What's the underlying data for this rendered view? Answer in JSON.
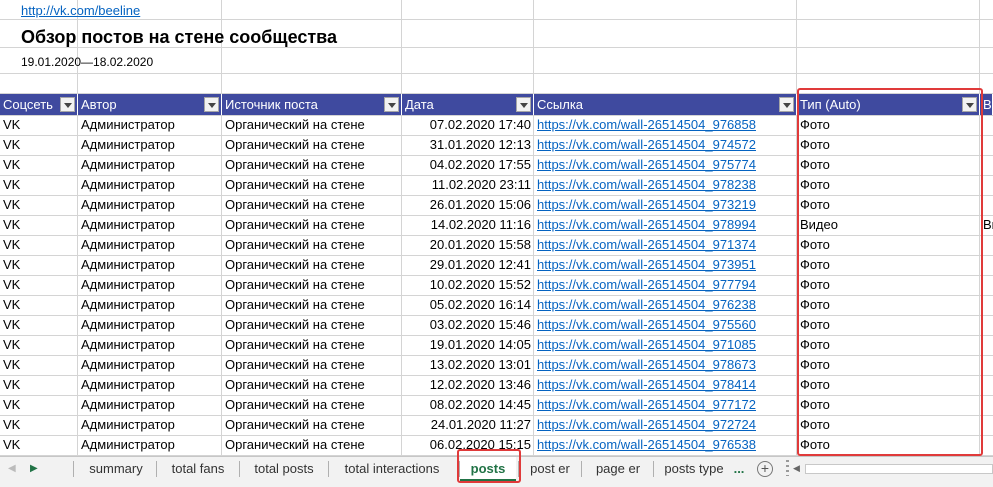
{
  "sheet": {
    "link": "http://vk.com/beeline",
    "title": "Обзор постов на стене сообщества",
    "date_range": "19.01.2020—18.02.2020",
    "columns": [
      "Соцсеть",
      "Автор",
      "Источник поста",
      "Дата",
      "Ссылка",
      "Тип (Auto)",
      "Во"
    ],
    "rows": [
      [
        "VK",
        "Администратор",
        "Органический на стене",
        "07.02.2020 17:40",
        "https://vk.com/wall-26514504_976858",
        "Фото",
        ""
      ],
      [
        "VK",
        "Администратор",
        "Органический на стене",
        "31.01.2020 12:13",
        "https://vk.com/wall-26514504_974572",
        "Фото",
        ""
      ],
      [
        "VK",
        "Администратор",
        "Органический на стене",
        "04.02.2020 17:55",
        "https://vk.com/wall-26514504_975774",
        "Фото",
        ""
      ],
      [
        "VK",
        "Администратор",
        "Органический на стене",
        "11.02.2020 23:11",
        "https://vk.com/wall-26514504_978238",
        "Фото",
        ""
      ],
      [
        "VK",
        "Администратор",
        "Органический на стене",
        "26.01.2020 15:06",
        "https://vk.com/wall-26514504_973219",
        "Фото",
        ""
      ],
      [
        "VK",
        "Администратор",
        "Органический на стене",
        "14.02.2020 11:16",
        "https://vk.com/wall-26514504_978994",
        "Видео",
        "Ви"
      ],
      [
        "VK",
        "Администратор",
        "Органический на стене",
        "20.01.2020 15:58",
        "https://vk.com/wall-26514504_971374",
        "Фото",
        ""
      ],
      [
        "VK",
        "Администратор",
        "Органический на стене",
        "29.01.2020 12:41",
        "https://vk.com/wall-26514504_973951",
        "Фото",
        ""
      ],
      [
        "VK",
        "Администратор",
        "Органический на стене",
        "10.02.2020 15:52",
        "https://vk.com/wall-26514504_977794",
        "Фото",
        ""
      ],
      [
        "VK",
        "Администратор",
        "Органический на стене",
        "05.02.2020 16:14",
        "https://vk.com/wall-26514504_976238",
        "Фото",
        ""
      ],
      [
        "VK",
        "Администратор",
        "Органический на стене",
        "03.02.2020 15:46",
        "https://vk.com/wall-26514504_975560",
        "Фото",
        ""
      ],
      [
        "VK",
        "Администратор",
        "Органический на стене",
        "19.01.2020 14:05",
        "https://vk.com/wall-26514504_971085",
        "Фото",
        ""
      ],
      [
        "VK",
        "Администратор",
        "Органический на стене",
        "13.02.2020 13:01",
        "https://vk.com/wall-26514504_978673",
        "Фото",
        ""
      ],
      [
        "VK",
        "Администратор",
        "Органический на стене",
        "12.02.2020 13:46",
        "https://vk.com/wall-26514504_978414",
        "Фото",
        ""
      ],
      [
        "VK",
        "Администратор",
        "Органический на стене",
        "08.02.2020 14:45",
        "https://vk.com/wall-26514504_977172",
        "Фото",
        ""
      ],
      [
        "VK",
        "Администратор",
        "Органический на стене",
        "24.01.2020 11:27",
        "https://vk.com/wall-26514504_972724",
        "Фото",
        ""
      ],
      [
        "VK",
        "Администратор",
        "Органический на стене",
        "06.02.2020 15:15",
        "https://vk.com/wall-26514504_976538",
        "Фото",
        ""
      ]
    ]
  },
  "tabs": {
    "items": [
      "summary",
      "total fans",
      "total posts",
      "total interactions",
      "posts",
      "post er",
      "page er",
      "posts type"
    ],
    "active": "posts",
    "more": "..."
  },
  "colors": {
    "header_bg": "#3f4a9f",
    "link": "#0563c1",
    "highlight": "#e03a3a",
    "active_tab": "#217346"
  },
  "icons": {
    "filter": "filter-dropdown-icon",
    "next_sheet": "play-right-icon",
    "add_sheet": "plus-circle-icon"
  }
}
